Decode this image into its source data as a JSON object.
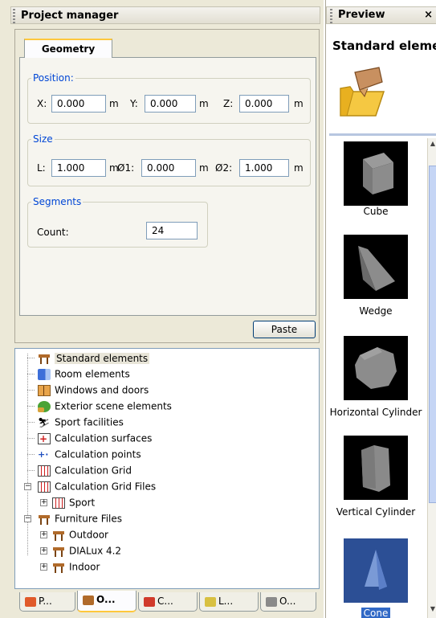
{
  "left_panel": {
    "title": "Project manager",
    "tab": "Geometry",
    "position": {
      "legend": "Position:",
      "x_label": "X:",
      "x_value": "0.000",
      "y_label": "Y:",
      "y_value": "0.000",
      "z_label": "Z:",
      "z_value": "0.000",
      "unit": "m"
    },
    "size": {
      "legend": "Size",
      "l_label": "L:",
      "l_value": "1.000",
      "d1_label": "Ø1:",
      "d1_value": "0.000",
      "d2_label": "Ø2:",
      "d2_value": "1.000",
      "unit": "m"
    },
    "segments": {
      "legend": "Segments",
      "count_label": "Count:",
      "count_value": "24"
    },
    "paste_label": "Paste"
  },
  "tree": {
    "items": [
      {
        "label": "Standard elements",
        "icon": "furniture-icon"
      },
      {
        "label": "Room elements",
        "icon": "room-icon"
      },
      {
        "label": "Windows and doors",
        "icon": "window-icon"
      },
      {
        "label": "Exterior scene elements",
        "icon": "tree-icon"
      },
      {
        "label": "Sport facilities",
        "icon": "sport-icon"
      },
      {
        "label": "Calculation surfaces",
        "icon": "calc-surface-icon"
      },
      {
        "label": "Calculation points",
        "icon": "calc-points-icon"
      },
      {
        "label": "Calculation Grid",
        "icon": "calc-grid-icon"
      },
      {
        "label": "Calculation Grid Files",
        "icon": "calc-grid-icon"
      },
      {
        "label": "Sport",
        "icon": "calc-grid-icon"
      },
      {
        "label": "Furniture Files",
        "icon": "furniture-icon"
      },
      {
        "label": "Outdoor",
        "icon": "furniture-icon"
      },
      {
        "label": "DIALux 4.2",
        "icon": "furniture-icon"
      },
      {
        "label": "Indoor",
        "icon": "furniture-icon"
      }
    ]
  },
  "bottom_tabs": [
    "P...",
    "O...",
    "C...",
    "L...",
    "O..."
  ],
  "right_panel": {
    "title": "Preview",
    "close": "×",
    "heading": "Standard eleme",
    "thumbnails": [
      "Cube",
      "Wedge",
      "Horizontal Cylinder",
      "Vertical Cylinder",
      "Cone"
    ],
    "selected": "Cone"
  },
  "colors": {
    "accent_tab": "#ffc83c",
    "legend_text": "#0046d5",
    "selection": "#3169c6"
  }
}
